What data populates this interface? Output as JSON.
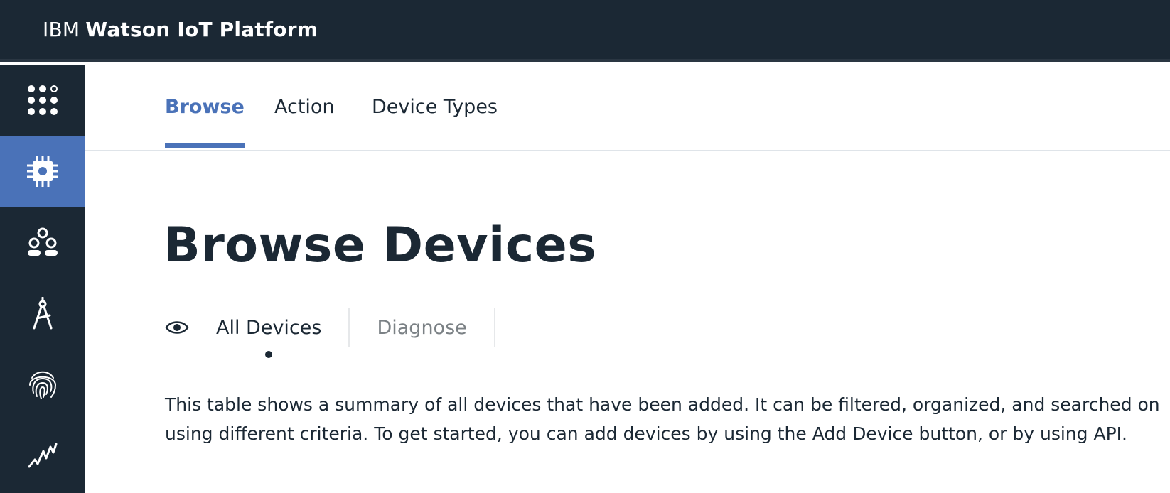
{
  "header": {
    "brand_prefix": "IBM",
    "brand_name": "Watson IoT Platform"
  },
  "sidebar": {
    "items": [
      {
        "icon": "app-grid-icon",
        "active": false
      },
      {
        "icon": "chip-icon",
        "active": true
      },
      {
        "icon": "members-icon",
        "active": false
      },
      {
        "icon": "compass-icon",
        "active": false
      },
      {
        "icon": "fingerprint-icon",
        "active": false
      },
      {
        "icon": "activity-icon",
        "active": false
      }
    ],
    "active_color": "#4a72b8"
  },
  "tabs": [
    {
      "label": "Browse",
      "active": true
    },
    {
      "label": "Action",
      "active": false
    },
    {
      "label": "Device Types",
      "active": false
    }
  ],
  "page": {
    "title": "Browse Devices",
    "view_switch": {
      "icon": "eye-icon",
      "items": [
        {
          "label": "All Devices",
          "active": true
        },
        {
          "label": "Diagnose",
          "active": false
        }
      ]
    },
    "description": "This table shows a summary of all devices that have been added. It can be filtered, organized, and searched on using different criteria. To get started, you can add devices by using the Add Device button, or by using API."
  },
  "colors": {
    "header_bg": "#1b2834",
    "accent": "#4a72b8",
    "text": "#1b2834"
  }
}
